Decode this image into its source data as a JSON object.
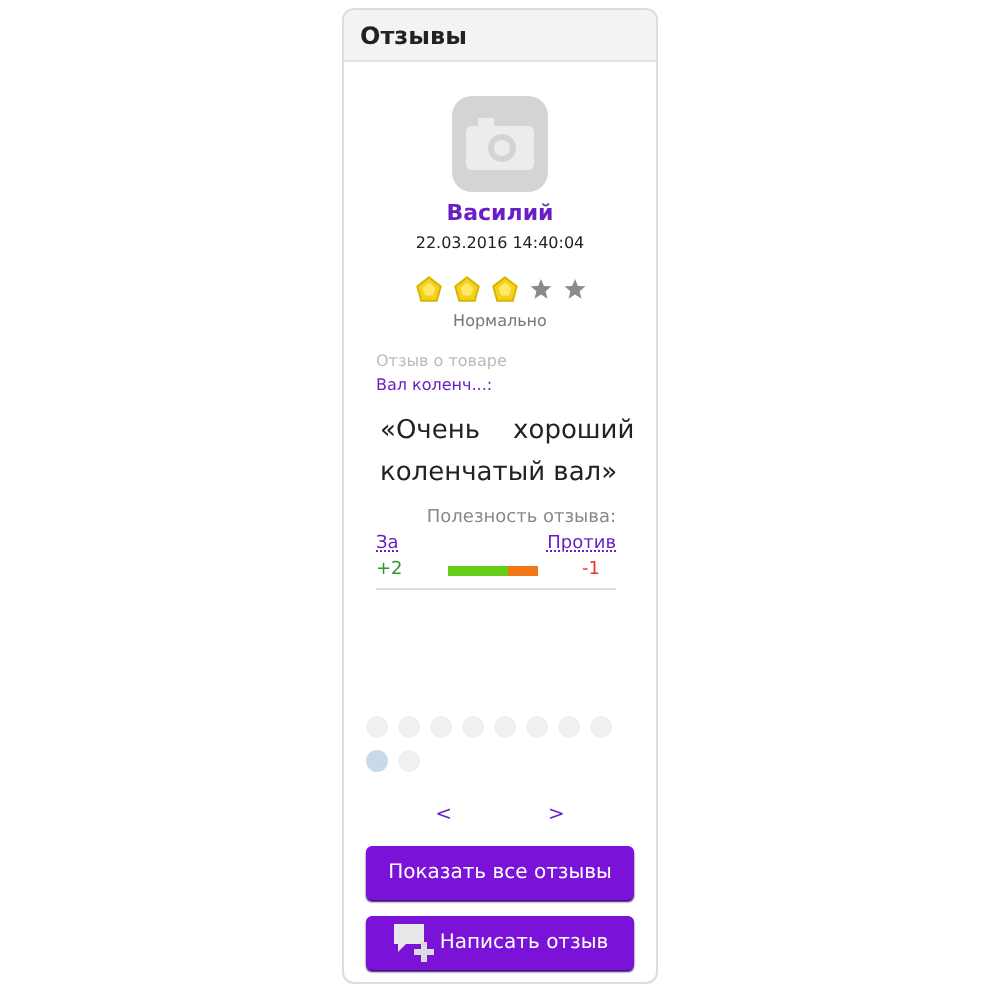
{
  "panel": {
    "title": "Отзывы"
  },
  "review": {
    "author": "Василий",
    "date": "22.03.2016 14:40:04",
    "stars": 3,
    "rating_label": "Нормально",
    "product_caption": "Отзыв о товаре",
    "product_link": "Вал коленч...:",
    "quote": "«Очень    хороший коленчатый вал»"
  },
  "usefulness": {
    "title": "Полезность отзыва:",
    "for_label": "За",
    "against_label": "Против",
    "for_count": "+2",
    "against_count": "-1",
    "level": 0.67
  },
  "pager": {
    "dots": [
      {
        "selected": false
      },
      {
        "selected": false
      },
      {
        "selected": false
      },
      {
        "selected": false
      },
      {
        "selected": false
      },
      {
        "selected": false
      },
      {
        "selected": false
      },
      {
        "selected": false
      },
      {
        "selected": true
      },
      {
        "selected": false
      }
    ],
    "prev": "<",
    "next": ">"
  },
  "buttons": [
    {
      "label": "Показать все отзывы",
      "kind": "plain"
    },
    {
      "label": "Написать отзыв",
      "kind": "icon"
    }
  ]
}
